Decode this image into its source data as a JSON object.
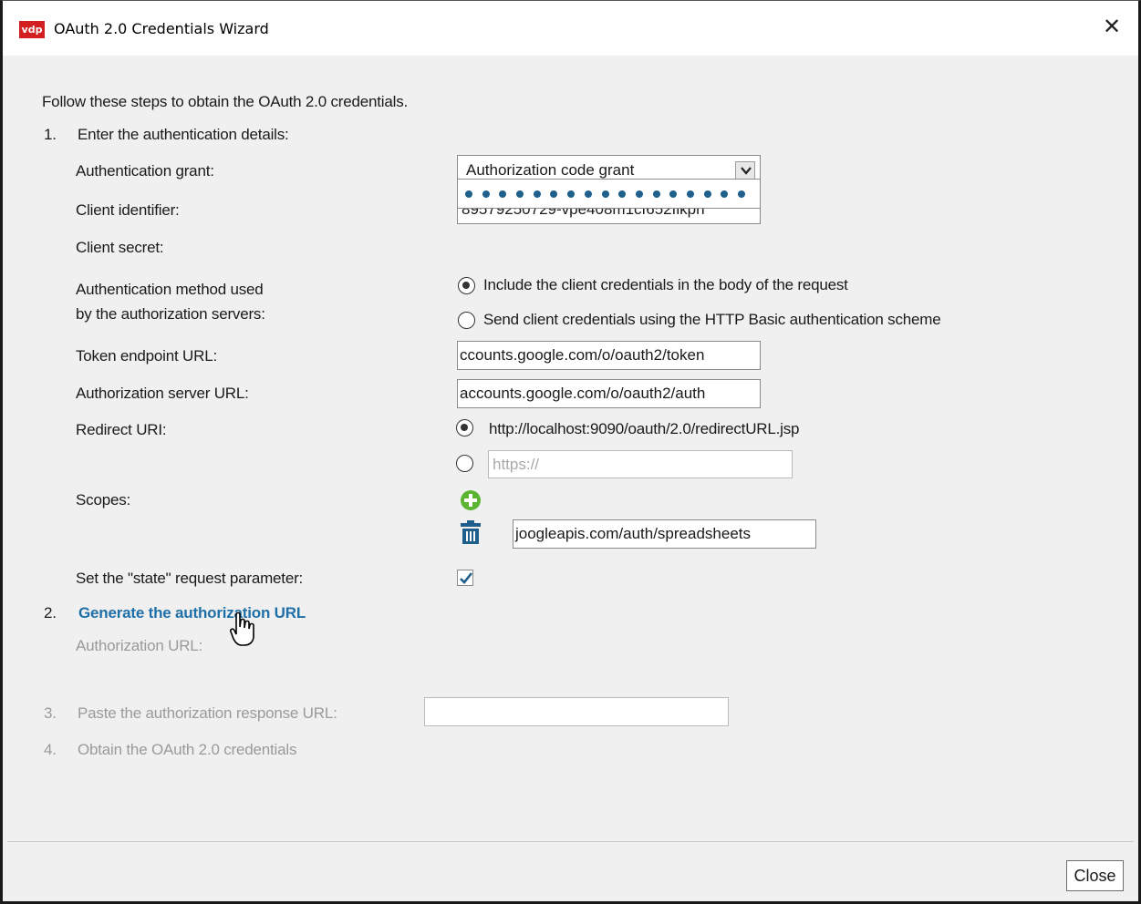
{
  "window": {
    "logo_text": "vdp",
    "title": "OAuth 2.0 Credentials Wizard",
    "close_glyph": "✕"
  },
  "intro": "Follow these steps to obtain the OAuth 2.0 credentials.",
  "step1": {
    "number": "1.",
    "title": "Enter the authentication details:",
    "grant_label": "Authentication grant:",
    "grant_value": "Authorization code grant",
    "client_id_label": "Client identifier:",
    "client_id_value": "89579250729-vpe408m1cf652flkph",
    "client_secret_label": "Client secret:",
    "auth_method_label_line1": "Authentication method used",
    "auth_method_label_line2": "by the authorization servers:",
    "auth_method_options": [
      "Include the client credentials in the body of the request",
      "Send client credentials using the HTTP Basic authentication scheme"
    ],
    "auth_method_selected": 0,
    "token_endpoint_label": "Token endpoint URL:",
    "token_endpoint_value": "ccounts.google.com/o/oauth2/token",
    "auth_server_label": "Authorization server URL:",
    "auth_server_value": "accounts.google.com/o/oauth2/auth",
    "redirect_label": "Redirect URI:",
    "redirect_default": "http://localhost:9090/oauth/2.0/redirectURL.jsp",
    "redirect_custom_placeholder": "https://",
    "scopes_label": "Scopes:",
    "scope_value": "joogleapis.com/auth/spreadsheets",
    "state_label": "Set the \"state\" request parameter:",
    "state_checked": true
  },
  "step2": {
    "number": "2.",
    "link": "Generate the authorization URL",
    "url_label": "Authorization URL:"
  },
  "step3": {
    "number": "3.",
    "label": "Paste the authorization response URL:",
    "value": ""
  },
  "step4": {
    "number": "4.",
    "label": "Obtain the OAuth 2.0 credentials"
  },
  "footer": {
    "close_label": "Close"
  },
  "colors": {
    "accent_link": "#1f6fa8",
    "add_icon": "#5cb531",
    "delete_icon": "#1f5f8b",
    "logo_bg": "#d1201f"
  },
  "icons": [
    "close-icon",
    "dropdown-arrow-icon",
    "add-scope-icon",
    "trash-icon",
    "checkmark-icon",
    "hand-cursor-icon"
  ]
}
